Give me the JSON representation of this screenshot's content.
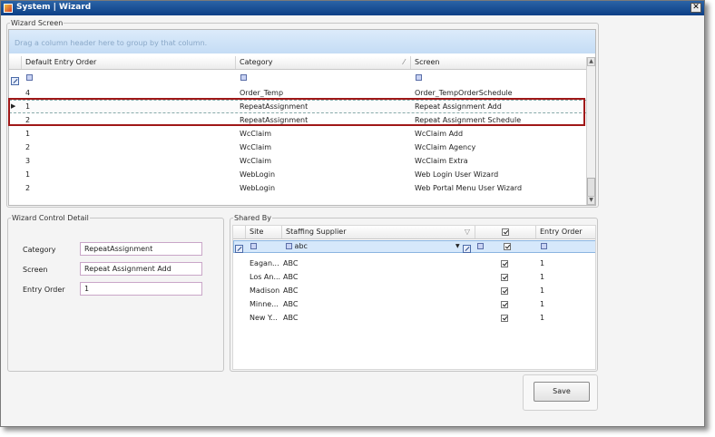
{
  "window": {
    "title": "System | Wizard",
    "close_glyph": "✕"
  },
  "wizard_screen": {
    "legend": "Wizard Screen",
    "group_hint": "Drag a column header here to group by that column.",
    "columns": [
      "Default Entry Order",
      "Category",
      "Screen"
    ],
    "rows": [
      {
        "order": "4",
        "category": "Order_Temp",
        "screen": "Order_TempOrderSchedule"
      },
      {
        "order": "1",
        "category": "RepeatAssignment",
        "screen": "Repeat Assignment Add"
      },
      {
        "order": "2",
        "category": "RepeatAssignment",
        "screen": "Repeat Assignment Schedule"
      },
      {
        "order": "1",
        "category": "WcClaim",
        "screen": "WcClaim Add"
      },
      {
        "order": "2",
        "category": "WcClaim",
        "screen": "WcClaim Agency"
      },
      {
        "order": "3",
        "category": "WcClaim",
        "screen": "WcClaim Extra"
      },
      {
        "order": "1",
        "category": "WebLogin",
        "screen": "Web Login User Wizard"
      },
      {
        "order": "2",
        "category": "WebLogin",
        "screen": "Web Portal Menu User Wizard"
      }
    ]
  },
  "control_detail": {
    "legend": "Wizard Control Detail",
    "category_label": "Category",
    "category_value": "RepeatAssignment",
    "screen_label": "Screen",
    "screen_value": "Repeat Assignment Add",
    "entry_order_label": "Entry Order",
    "entry_order_value": "1"
  },
  "shared_by": {
    "legend": "Shared By",
    "columns": [
      "Site",
      "Staffing Supplier",
      "",
      "Entry Order"
    ],
    "filter_supplier": "abc",
    "rows": [
      {
        "site": "Eagan...",
        "supplier": "ABC",
        "checked": true,
        "order": "1"
      },
      {
        "site": "Los An...",
        "supplier": "ABC",
        "checked": true,
        "order": "1"
      },
      {
        "site": "Madison",
        "supplier": "ABC",
        "checked": true,
        "order": "1"
      },
      {
        "site": "Minne...",
        "supplier": "ABC",
        "checked": true,
        "order": "1"
      },
      {
        "site": "New Y...",
        "supplier": "ABC",
        "checked": true,
        "order": "1"
      }
    ]
  },
  "actions": {
    "save_label": "Save"
  },
  "colors": {
    "selection_border": "#a01818",
    "title_bar": "#0c3f86",
    "group_bar": "#c4dcf5"
  }
}
